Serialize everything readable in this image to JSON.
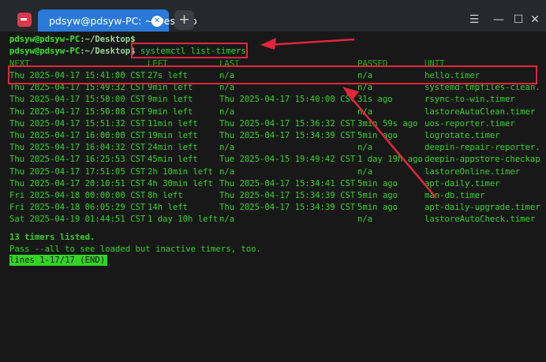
{
  "window": {
    "tab_title": "pdsyw@pdsyw-PC: ~/Desktop",
    "new_tab_symbol": "+",
    "menu_symbol": "☰",
    "minimize_symbol": "—",
    "maximize_symbol": "☐",
    "close_symbol": "✕"
  },
  "terminal": {
    "prompt1_user": "pdsyw@pdsyw-PC",
    "prompt1_path": ":~/Desktop$",
    "prompt2_user": "pdsyw@pdsyw-PC",
    "prompt2_path": ":~/Desktop$",
    "command": "systemctl list-timers",
    "headers": {
      "next": "NEXT",
      "left": "LEFT",
      "last": "LAST",
      "passed": "PASSED",
      "unit": "UNIT"
    },
    "rows": [
      {
        "next": "Thu 2025-04-17 15:41:00 CST",
        "left": "27s left",
        "last": "n/a",
        "passed": "n/a",
        "unit": "hello.timer"
      },
      {
        "next": "Thu 2025-04-17 15:49:32 CST",
        "left": "9min left",
        "last": "n/a",
        "passed": "n/a",
        "unit": "systemd-tmpfiles-clean."
      },
      {
        "next": "Thu 2025-04-17 15:50:00 CST",
        "left": "9min left",
        "last": "Thu 2025-04-17 15:40:00 CST",
        "passed": "31s ago",
        "unit": "rsync-to-win.timer"
      },
      {
        "next": "Thu 2025-04-17 15:50:08 CST",
        "left": "9min left",
        "last": "n/a",
        "passed": "n/a",
        "unit": "lastoreAutoClean.timer"
      },
      {
        "next": "Thu 2025-04-17 15:51:32 CST",
        "left": "11min left",
        "last": "Thu 2025-04-17 15:36:32 CST",
        "passed": "3min 59s ago",
        "unit": "uos-reporter.timer"
      },
      {
        "next": "Thu 2025-04-17 16:00:00 CST",
        "left": "19min left",
        "last": "Thu 2025-04-17 15:34:39 CST",
        "passed": "5min ago",
        "unit": "logrotate.timer"
      },
      {
        "next": "Thu 2025-04-17 16:04:32 CST",
        "left": "24min left",
        "last": "n/a",
        "passed": "n/a",
        "unit": "deepin-repair-reporter."
      },
      {
        "next": "Thu 2025-04-17 16:25:53 CST",
        "left": "45min left",
        "last": "Tue 2025-04-15 19:49:42 CST",
        "passed": "1 day 19h ago",
        "unit": "deepin-appstore-checkap"
      },
      {
        "next": "Thu 2025-04-17 17:51:05 CST",
        "left": "2h 10min left",
        "last": "n/a",
        "passed": "n/a",
        "unit": "lastoreOnline.timer"
      },
      {
        "next": "Thu 2025-04-17 20:10:51 CST",
        "left": "4h 30min left",
        "last": "Thu 2025-04-17 15:34:41 CST",
        "passed": "5min ago",
        "unit": "apt-daily.timer"
      },
      {
        "next": "Fri 2025-04-18 00:00:00 CST",
        "left": "8h left",
        "last": "Thu 2025-04-17 15:34:39 CST",
        "passed": "5min ago",
        "unit": "man-db.timer"
      },
      {
        "next": "Fri 2025-04-18 06:05:29 CST",
        "left": "14h left",
        "last": "Thu 2025-04-17 15:34:39 CST",
        "passed": "5min ago",
        "unit": "apt-daily-upgrade.timer"
      },
      {
        "next": "Sat 2025-04-19 01:44:51 CST",
        "left": "1 day 10h left",
        "last": "n/a",
        "passed": "n/a",
        "unit": "lastoreAutoCheck.timer"
      }
    ],
    "summary": "13 timers listed.",
    "hint": "Pass --all to see loaded but inactive timers, too.",
    "pager_status": "lines 1-17/17 (END)"
  },
  "colors": {
    "terminal_text": "#33d426",
    "tab_active": "#2a79d9",
    "annotation": "#e2263c"
  }
}
